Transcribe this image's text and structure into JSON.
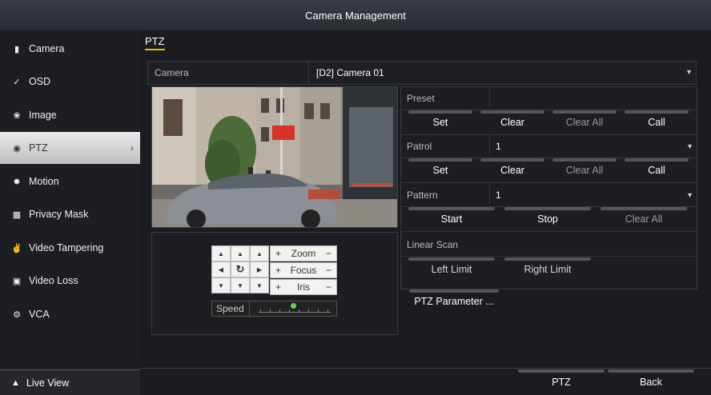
{
  "window": {
    "title": "Camera Management"
  },
  "sidebar": {
    "items": [
      {
        "label": "Camera",
        "icon": "camera-icon"
      },
      {
        "label": "OSD",
        "icon": "osd-icon"
      },
      {
        "label": "Image",
        "icon": "image-icon"
      },
      {
        "label": "PTZ",
        "icon": "ptz-icon",
        "active": true
      },
      {
        "label": "Motion",
        "icon": "motion-icon"
      },
      {
        "label": "Privacy Mask",
        "icon": "privacy-mask-icon"
      },
      {
        "label": "Video Tampering",
        "icon": "video-tampering-icon"
      },
      {
        "label": "Video Loss",
        "icon": "video-loss-icon"
      },
      {
        "label": "VCA",
        "icon": "vca-icon"
      }
    ],
    "live_view": "Live View"
  },
  "main": {
    "tab": "PTZ",
    "camera_label": "Camera",
    "camera_value": "[D2] Camera 01"
  },
  "ptz_controls": {
    "zoom": "Zoom",
    "focus": "Focus",
    "iris": "Iris",
    "plus": "+",
    "minus": "−",
    "speed_label": "Speed"
  },
  "preset": {
    "label": "Preset",
    "value": "",
    "buttons": [
      "Set",
      "Clear",
      "Clear All",
      "Call"
    ]
  },
  "patrol": {
    "label": "Patrol",
    "value": "1",
    "buttons": [
      "Set",
      "Clear",
      "Clear All",
      "Call"
    ]
  },
  "pattern": {
    "label": "Pattern",
    "value": "1",
    "buttons": [
      "Start",
      "Stop",
      "Clear All"
    ]
  },
  "linear_scan": {
    "label": "Linear Scan",
    "buttons": [
      "Left Limit",
      "Right Limit"
    ]
  },
  "ptz_parameter_button": "PTZ Parameter ...",
  "footer": {
    "ptz": "PTZ",
    "back": "Back"
  },
  "colors": {
    "tab_underline": "#e6c000",
    "active_bg": "#d9d9d9",
    "speed_knob": "#6ccf5a"
  }
}
